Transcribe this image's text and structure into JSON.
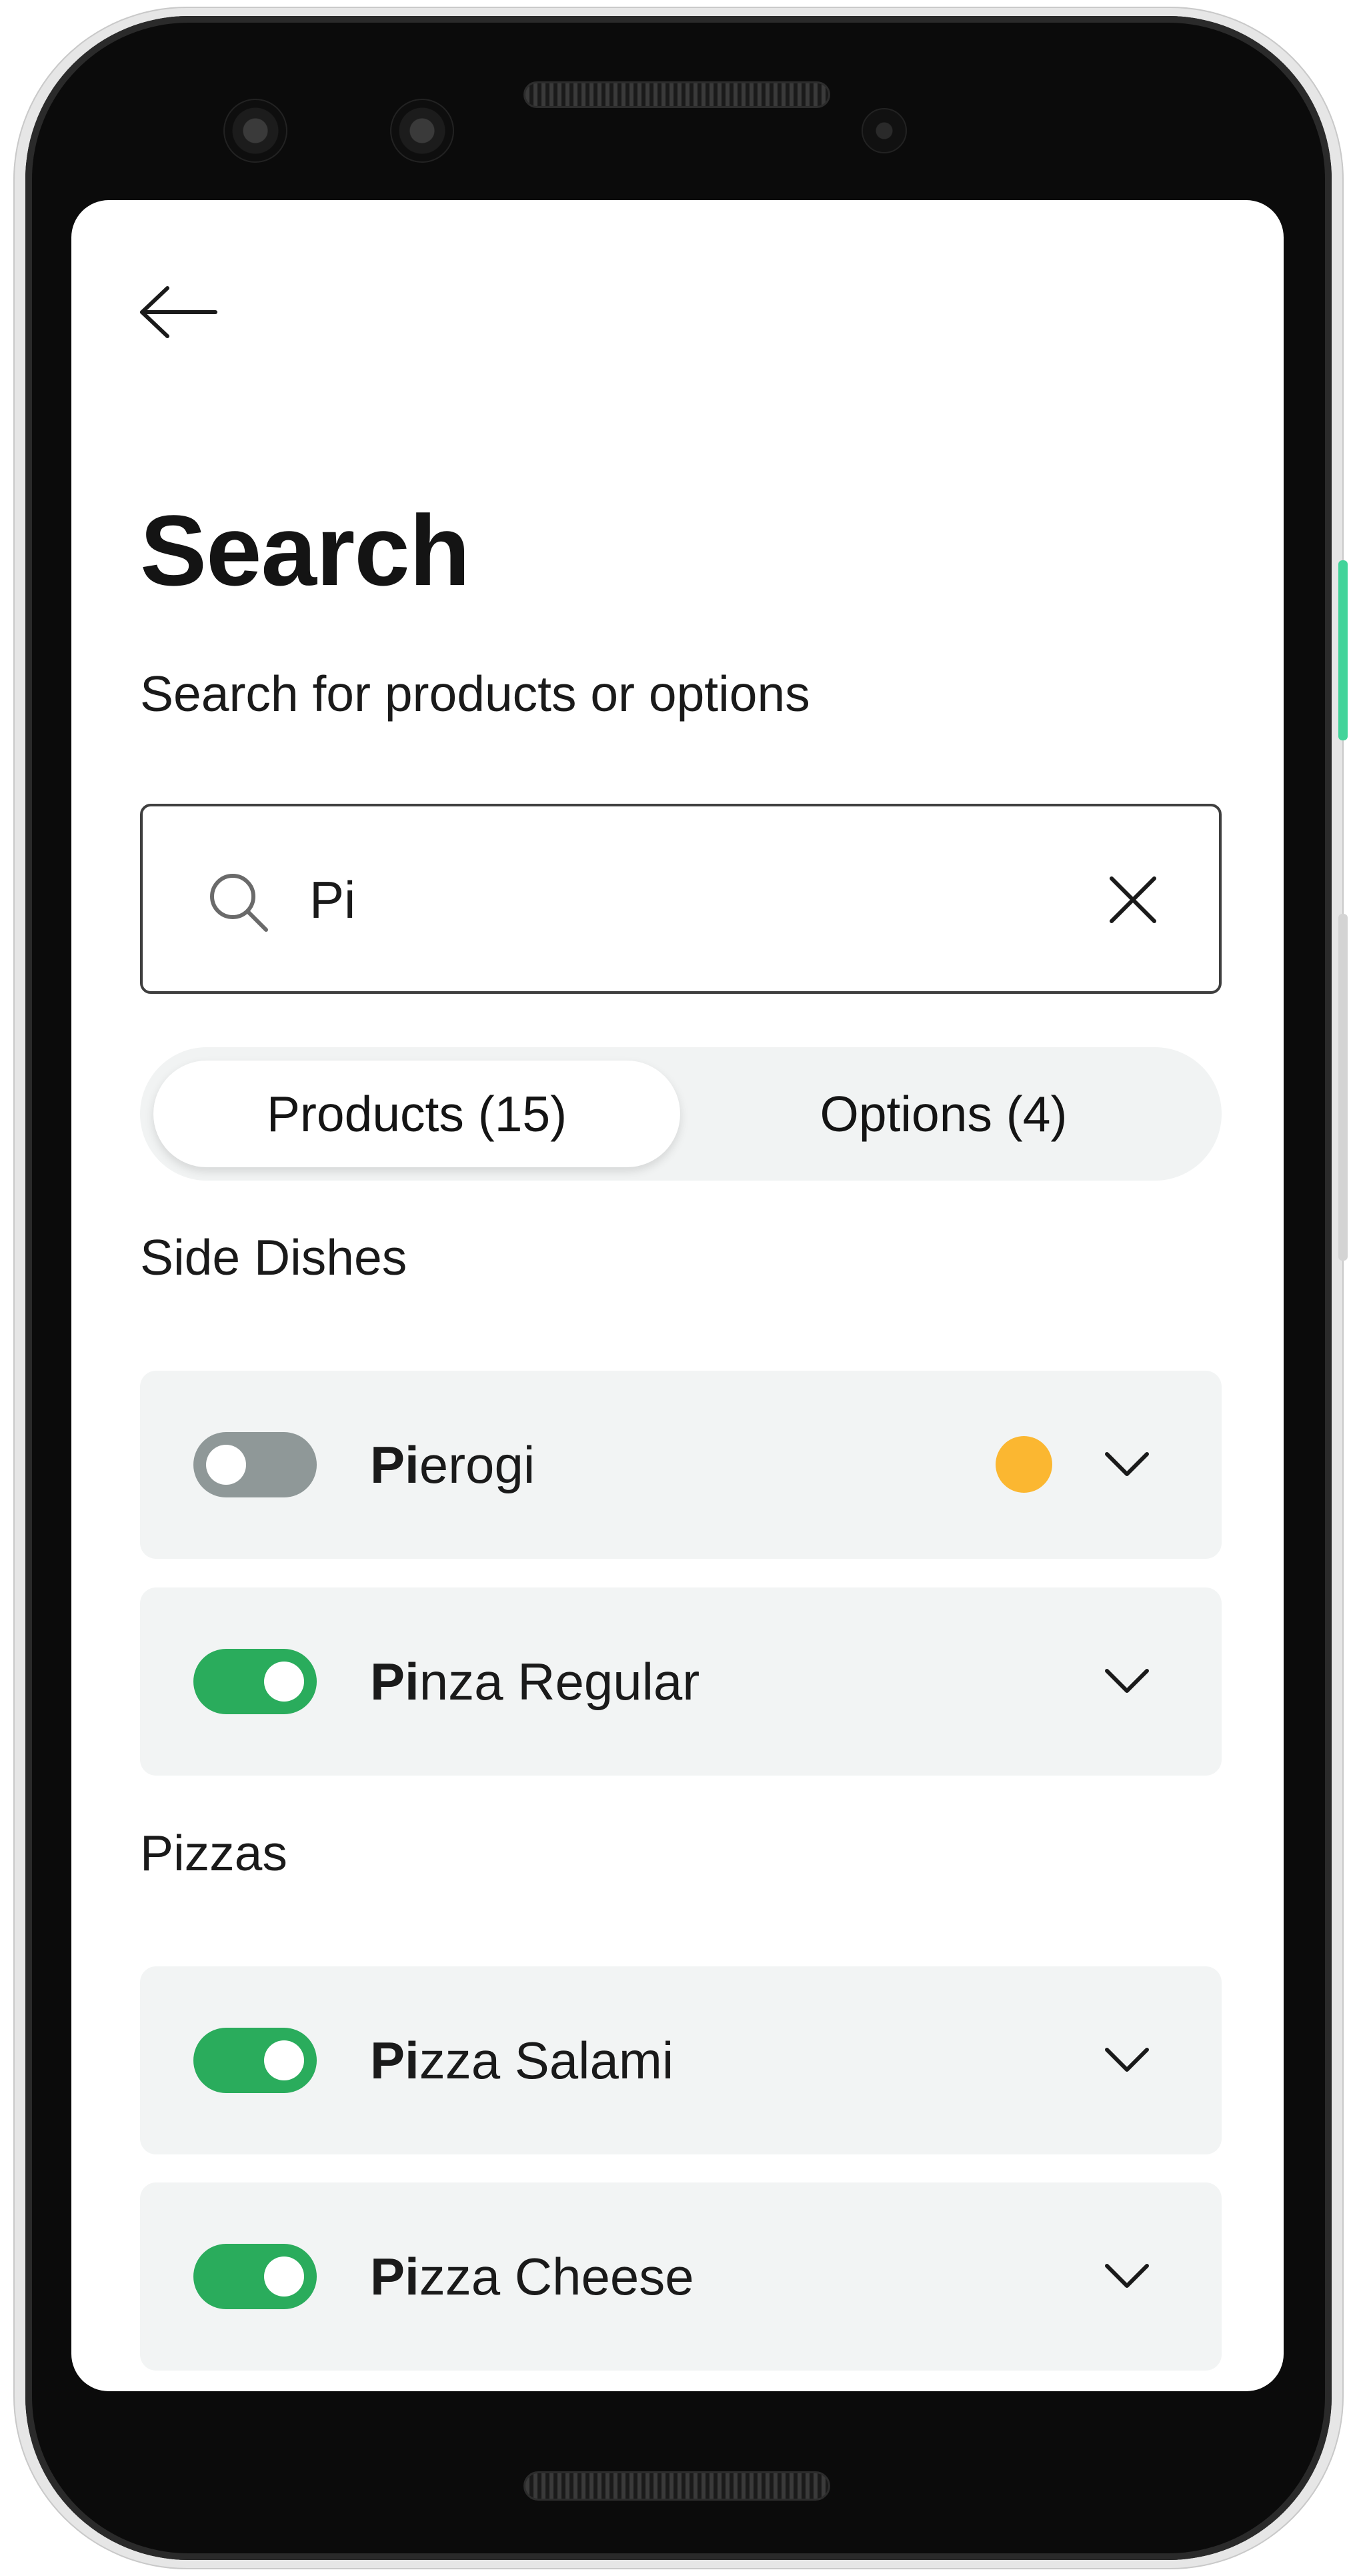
{
  "screen": {
    "title": "Search",
    "subtitle": "Search for products or options"
  },
  "search": {
    "value": "Pi",
    "icon": "search-icon",
    "clear_icon": "close-icon"
  },
  "tabs": [
    {
      "label": "Products (15)",
      "selected": true
    },
    {
      "label": "Options (4)",
      "selected": false
    }
  ],
  "sections": [
    {
      "title": "Side Dishes",
      "items": [
        {
          "match": "Pi",
          "rest": "erogi",
          "enabled": false,
          "warning": true
        },
        {
          "match": "Pi",
          "rest": "nza Regular",
          "enabled": true,
          "warning": false
        }
      ]
    },
    {
      "title": "Pizzas",
      "items": [
        {
          "match": "Pi",
          "rest": "zza Salami",
          "enabled": true,
          "warning": false
        },
        {
          "match": "Pi",
          "rest": "zza Cheese",
          "enabled": true,
          "warning": false
        }
      ]
    }
  ],
  "colors": {
    "toggle_on": "#2aac5c",
    "toggle_off": "#8f9898",
    "warning_dot": "#fbb731",
    "row_background": "#f2f4f4"
  }
}
